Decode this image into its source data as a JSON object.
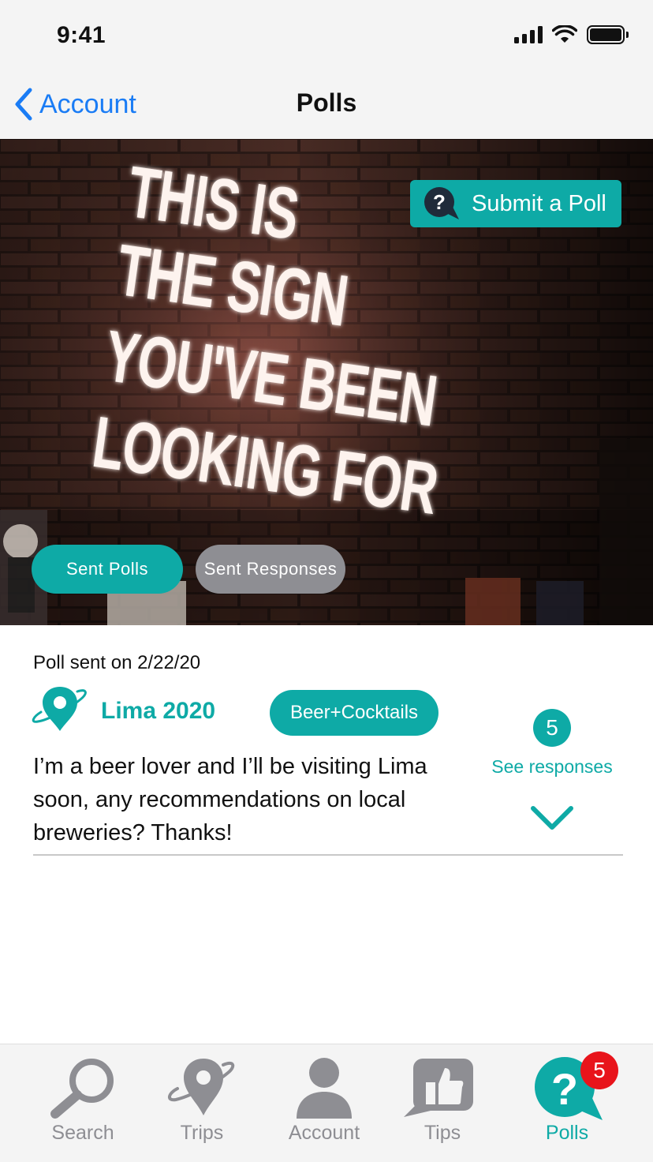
{
  "status_bar": {
    "time": "9:41"
  },
  "nav": {
    "back_label": "Account",
    "title": "Polls"
  },
  "hero": {
    "submit_label": "Submit a Poll",
    "tabs": [
      {
        "label": "Sent Polls",
        "active": true
      },
      {
        "label": "Sent Responses",
        "active": false
      }
    ]
  },
  "poll": {
    "date_label": "Poll sent on 2/22/20",
    "trip_name": "Lima 2020",
    "category": "Beer+Cocktails",
    "question": "I’m a beer lover and I’ll be visiting Lima soon, any recommendations on local breweries? Thanks!",
    "response_count": "5",
    "see_responses_label": "See responses"
  },
  "tab_bar": {
    "items": [
      {
        "label": "Search",
        "icon": "search-icon"
      },
      {
        "label": "Trips",
        "icon": "trips-icon"
      },
      {
        "label": "Account",
        "icon": "account-icon"
      },
      {
        "label": "Tips",
        "icon": "tips-icon"
      },
      {
        "label": "Polls",
        "icon": "polls-icon",
        "active": true
      }
    ],
    "polls_badge": "5"
  },
  "colors": {
    "accent": "#0eaaa6",
    "link": "#1a7cf5",
    "inactive": "#8e8e93",
    "badge": "#e8141b"
  }
}
